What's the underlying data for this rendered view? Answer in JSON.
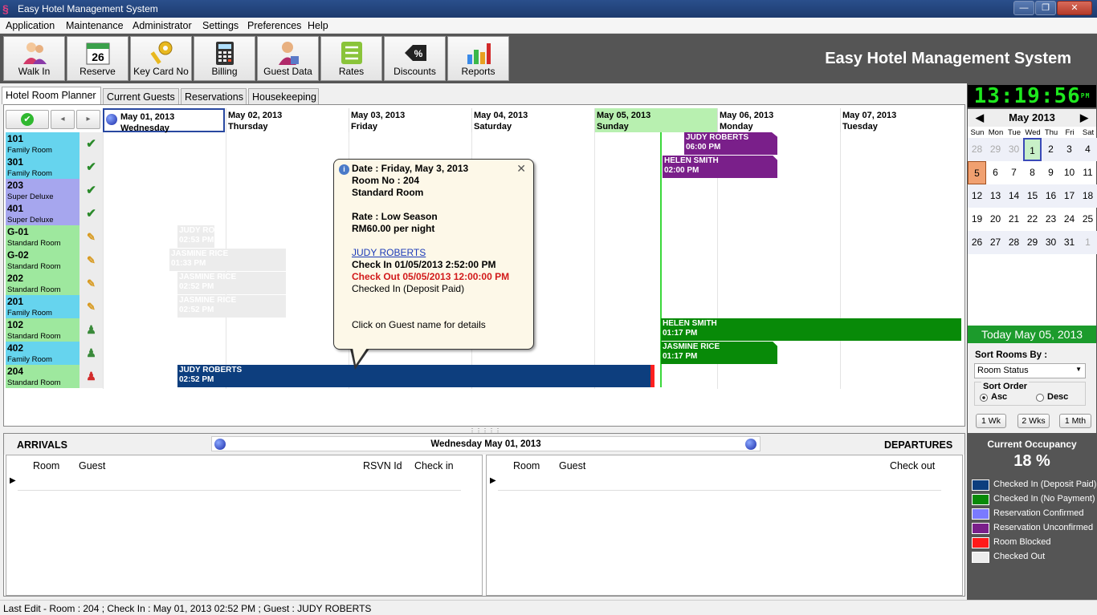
{
  "window": {
    "title": "Easy Hotel Management System"
  },
  "menu": [
    "Application",
    "Maintenance",
    "Administrator",
    "Settings",
    "Preferences",
    "Help"
  ],
  "toolbar": {
    "buttons": [
      {
        "label": "Walk In",
        "icon": "walk-in-icon"
      },
      {
        "label": "Reserve",
        "icon": "calendar-icon",
        "badge": "26"
      },
      {
        "label": "Key Card No",
        "icon": "key-icon"
      },
      {
        "label": "Billing",
        "icon": "calculator-icon"
      },
      {
        "label": "Guest Data",
        "icon": "guest-data-icon"
      },
      {
        "label": "Rates",
        "icon": "rates-list-icon"
      },
      {
        "label": "Discounts",
        "icon": "discount-tag-icon",
        "badge": "%"
      },
      {
        "label": "Reports",
        "icon": "bar-chart-icon"
      }
    ],
    "brand": "Easy Hotel Management System"
  },
  "tabs": [
    "Hotel Room Planner",
    "Current Guests",
    "Reservations",
    "Housekeeping"
  ],
  "planner": {
    "days": [
      {
        "date": "May 01, 2013",
        "weekday": "Wednesday"
      },
      {
        "date": "May 02, 2013",
        "weekday": "Thursday"
      },
      {
        "date": "May 03, 2013",
        "weekday": "Friday"
      },
      {
        "date": "May 04, 2013",
        "weekday": "Saturday"
      },
      {
        "date": "May 05, 2013",
        "weekday": "Sunday"
      },
      {
        "date": "May 06, 2013",
        "weekday": "Monday"
      },
      {
        "date": "May 07, 2013",
        "weekday": "Tuesday"
      }
    ],
    "rooms": [
      {
        "no": "101",
        "type": "Family Room",
        "status": "ready",
        "color": "#66d4ee"
      },
      {
        "no": "301",
        "type": "Family Room",
        "status": "ready",
        "color": "#66d4ee"
      },
      {
        "no": "203",
        "type": "Super Deluxe",
        "status": "ready",
        "color": "#a6a6ee"
      },
      {
        "no": "401",
        "type": "Super Deluxe",
        "status": "ready",
        "color": "#a6a6ee"
      },
      {
        "no": "G-01",
        "type": "Standard Room",
        "status": "cleaning",
        "color": "#9ee89e"
      },
      {
        "no": "G-02",
        "type": "Standard Room",
        "status": "cleaning",
        "color": "#9ee89e"
      },
      {
        "no": "202",
        "type": "Standard Room",
        "status": "cleaning",
        "color": "#9ee89e"
      },
      {
        "no": "201",
        "type": "Family Room",
        "status": "cleaning",
        "color": "#66d4ee"
      },
      {
        "no": "102",
        "type": "Standard Room",
        "status": "occupied",
        "color": "#9ee89e"
      },
      {
        "no": "402",
        "type": "Family Room",
        "status": "occupied",
        "color": "#66d4ee"
      },
      {
        "no": "204",
        "type": "Standard Room",
        "status": "occupied-red",
        "color": "#9ee89e"
      }
    ],
    "bookings": [
      {
        "name": "JUDY ROBERTS",
        "time": "06:00 PM",
        "kind": "purple"
      },
      {
        "name": "HELEN SMITH",
        "time": "02:00 PM",
        "kind": "purple"
      },
      {
        "name": "JUDY RO",
        "time": "02:53 PM",
        "kind": "ghost"
      },
      {
        "name": "JASMINE RICE",
        "time": "01:33 PM",
        "kind": "ghost"
      },
      {
        "name": "JASMINE RICE",
        "time": "02:52 PM",
        "kind": "ghost"
      },
      {
        "name": "JASMINE RICE",
        "time": "02:52 PM",
        "kind": "ghost"
      },
      {
        "name": "HELEN SMITH",
        "time": "01:17 PM",
        "kind": "green"
      },
      {
        "name": "JASMINE RICE",
        "time": "01:17 PM",
        "kind": "green"
      },
      {
        "name": "JUDY ROBERTS",
        "time": "02:52 PM",
        "kind": "navy"
      }
    ]
  },
  "popup": {
    "date": "Date : Friday, May 3, 2013",
    "room": "Room No : 204",
    "roomtype": "Standard Room",
    "rate": "Rate : Low Season",
    "price": "RM60.00 per night",
    "guest": "JUDY ROBERTS",
    "checkin": "Check In 01/05/2013 2:52:00 PM",
    "checkout": "Check Out 05/05/2013 12:00:00 PM",
    "status": "Checked In (Deposit Paid)",
    "hint": "Click on Guest name for details"
  },
  "bottom": {
    "arrivals": "ARRIVALS",
    "departures": "DEPARTURES",
    "date": "Wednesday May 01, 2013",
    "arr_cols": [
      "Room",
      "Guest",
      "RSVN Id",
      "Check in"
    ],
    "dep_cols": [
      "Room",
      "Guest",
      "Check out"
    ]
  },
  "status": "Last Edit -  Room : 204 ; Check In : May 01, 2013 02:52 PM ; Guest : JUDY ROBERTS",
  "right": {
    "clock": "13:19:56",
    "ampm": "PM",
    "month": "May 2013",
    "dow": [
      "Sun",
      "Mon",
      "Tue",
      "Wed",
      "Thu",
      "Fri",
      "Sat"
    ],
    "weeks": [
      [
        "28",
        "29",
        "30",
        "1",
        "2",
        "3",
        "4"
      ],
      [
        "5",
        "6",
        "7",
        "8",
        "9",
        "10",
        "11"
      ],
      [
        "12",
        "13",
        "14",
        "15",
        "16",
        "17",
        "18"
      ],
      [
        "19",
        "20",
        "21",
        "22",
        "23",
        "24",
        "25"
      ],
      [
        "26",
        "27",
        "28",
        "29",
        "30",
        "31",
        "1"
      ]
    ],
    "today": "Today May 05, 2013",
    "sort_label": "Sort Rooms By :",
    "sort_value": "Room Status",
    "sort_order": "Sort Order",
    "asc": "Asc",
    "desc": "Desc",
    "ranges": [
      "1 Wk",
      "2 Wks",
      "1 Mth"
    ],
    "occ_label": "Current Occupancy",
    "occ_value": "18 %",
    "legend": [
      {
        "label": "Checked In (Deposit Paid)",
        "color": "#0d3e7e"
      },
      {
        "label": "Checked In (No Payment)",
        "color": "#088a08"
      },
      {
        "label": "Reservation Confirmed",
        "color": "#7a7aff"
      },
      {
        "label": "Reservation Unconfirmed",
        "color": "#7a1f8a"
      },
      {
        "label": "Room Blocked",
        "color": "#ff1a1a"
      },
      {
        "label": "Checked Out",
        "color": "#ececec"
      }
    ]
  }
}
